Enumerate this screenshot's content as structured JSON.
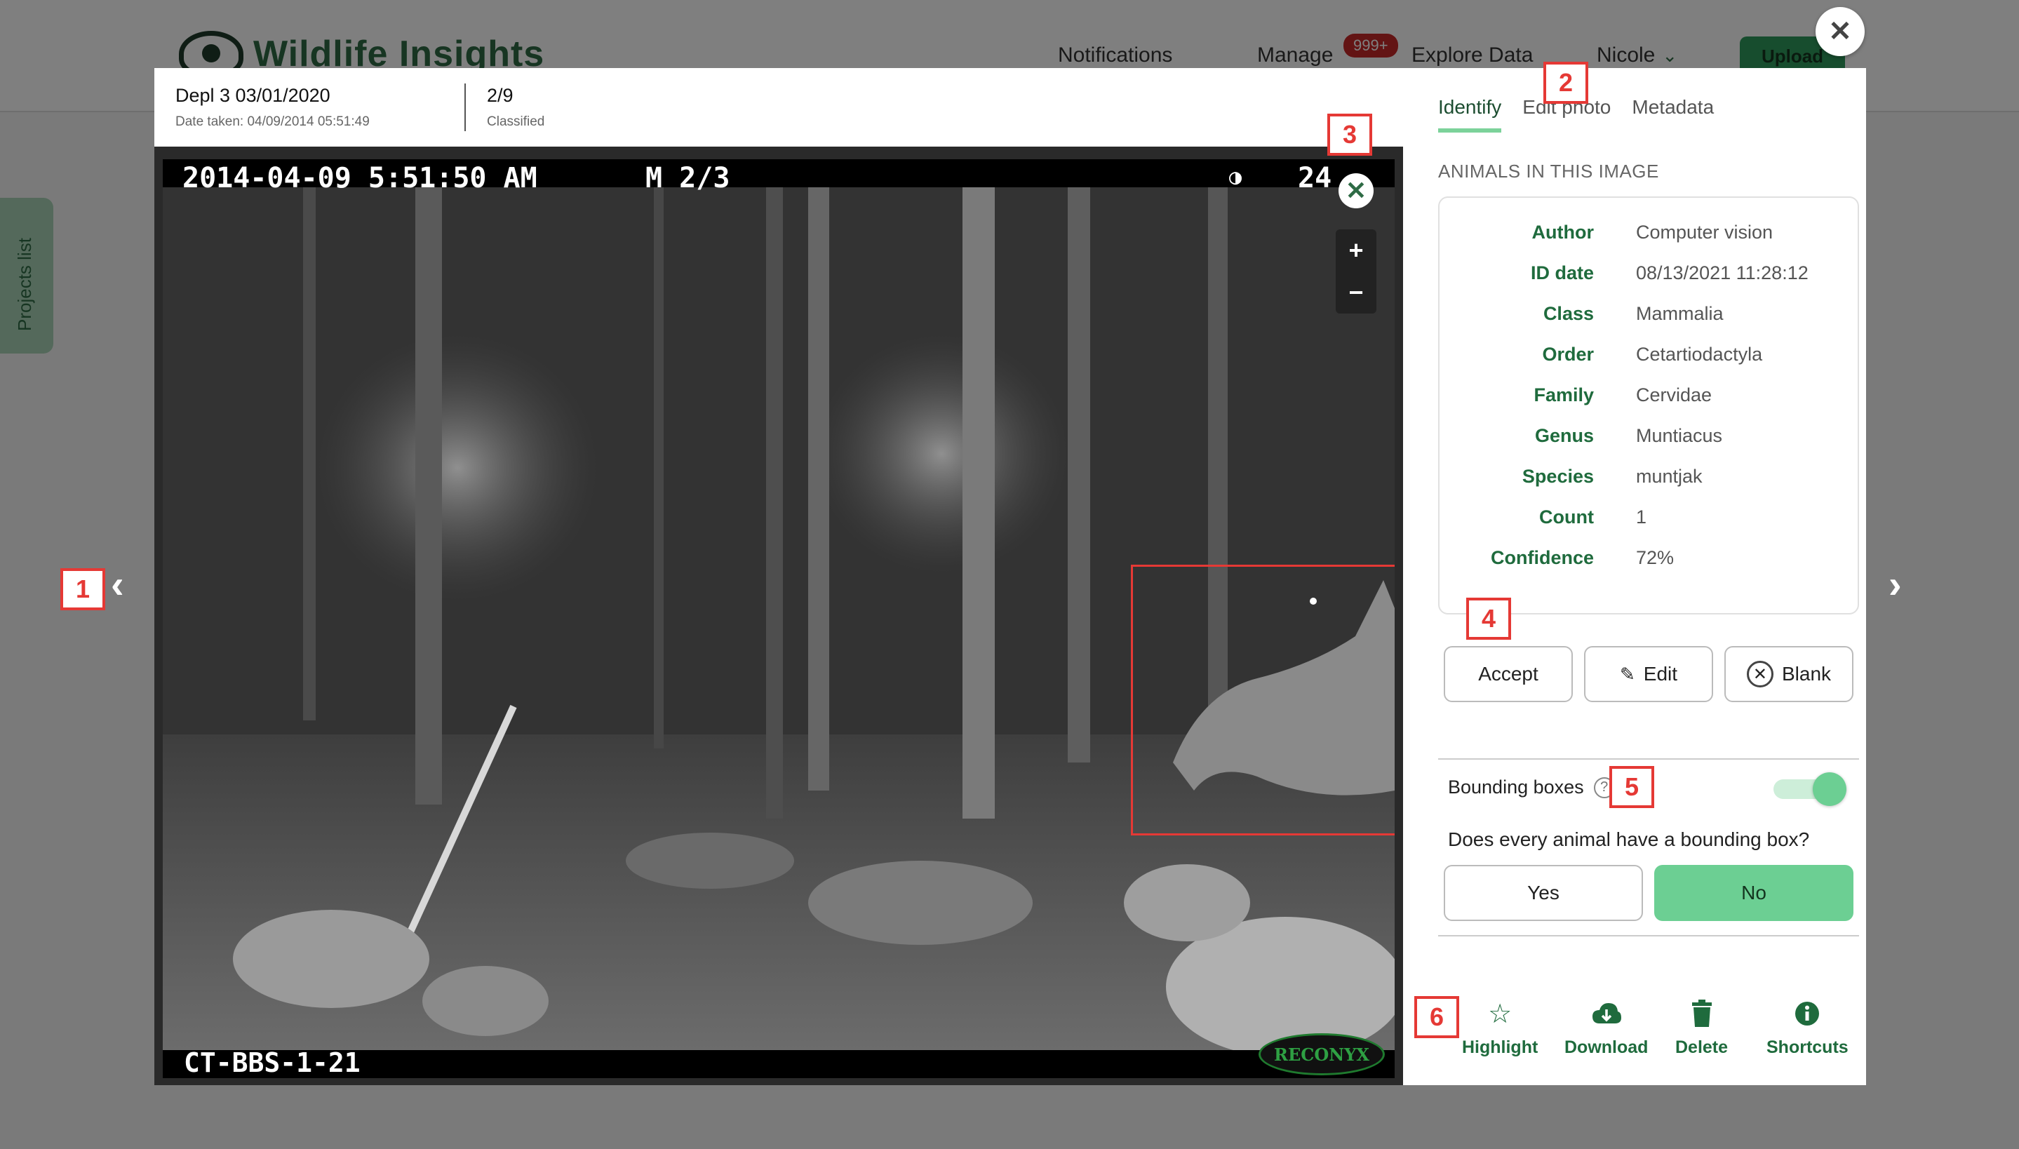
{
  "app": {
    "logo_text": "Wildlife Insights",
    "nav": {
      "notifications": "Notifications",
      "manage": "Manage",
      "manage_badge": "999+",
      "explore": "Explore Data",
      "user": "Nicole",
      "upload": "Upload"
    },
    "projects_tab": "Projects list"
  },
  "modal": {
    "header": {
      "deployment": "Depl 3 03/01/2020",
      "date_taken": "Date taken: 04/09/2014 05:51:49",
      "position": "2/9",
      "status": "Classified"
    },
    "photo": {
      "timestamp": "2014-04-09 5:51:50 AM",
      "burst": "M 2/3",
      "temp": "24",
      "camera_id": "CT-BBS-1-21",
      "brand": "RECONYX",
      "zoom_in": "+",
      "zoom_out": "−"
    },
    "tabs": [
      {
        "label": "Identify",
        "active": true
      },
      {
        "label": "Edit photo",
        "active": false
      },
      {
        "label": "Metadata",
        "active": false
      }
    ],
    "section_label": "ANIMALS IN THIS IMAGE",
    "identification": [
      {
        "key": "Author",
        "value": "Computer vision"
      },
      {
        "key": "ID date",
        "value": "08/13/2021 11:28:12"
      },
      {
        "key": "Class",
        "value": "Mammalia"
      },
      {
        "key": "Order",
        "value": "Cetartiodactyla"
      },
      {
        "key": "Family",
        "value": "Cervidae"
      },
      {
        "key": "Genus",
        "value": "Muntiacus"
      },
      {
        "key": "Species",
        "value": "muntjak"
      },
      {
        "key": "Count",
        "value": "1"
      },
      {
        "key": "Confidence",
        "value": "72%"
      }
    ],
    "actions": {
      "accept": "Accept",
      "edit": "Edit",
      "blank": "Blank"
    },
    "bounding": {
      "label": "Bounding boxes",
      "help": "?",
      "enabled": true,
      "question": "Does every animal have a bounding box?",
      "yes": "Yes",
      "no": "No"
    },
    "footer": {
      "highlight": "Highlight",
      "download": "Download",
      "delete": "Delete",
      "shortcuts": "Shortcuts"
    }
  },
  "markers": [
    "1",
    "2",
    "3",
    "4",
    "5",
    "6"
  ],
  "colors": {
    "accent": "#6ccf93",
    "label_green": "#1f6b3d",
    "marker_red": "#e53935"
  }
}
